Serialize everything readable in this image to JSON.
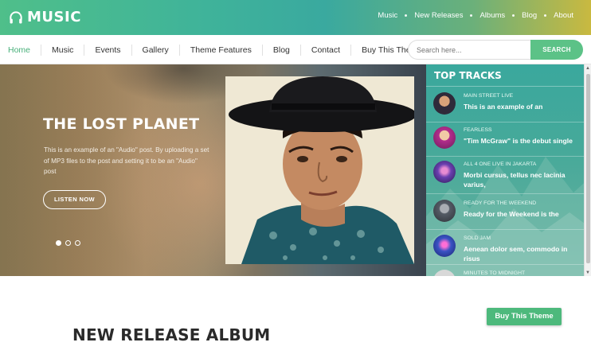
{
  "brand": {
    "name": "MUSIC"
  },
  "top_nav": {
    "items": [
      "Music",
      "New Releases",
      "Albums",
      "Blog",
      "About"
    ]
  },
  "main_nav": {
    "items": [
      "Home",
      "Music",
      "Events",
      "Gallery",
      "Theme Features",
      "Blog",
      "Contact",
      "Buy This Theme"
    ],
    "active": "Home"
  },
  "search": {
    "placeholder": "Search here...",
    "button": "SEARCH"
  },
  "hero": {
    "title": "THE LOST PLANET",
    "description": "This is an example of an \"Audio\" post. By uploading a set of MP3 files to the post and setting it to be an \"Audio\" post",
    "button": "LISTEN NOW",
    "slides": 3,
    "active_slide": 1
  },
  "top_tracks": {
    "title": "TOP TRACKS",
    "items": [
      {
        "label": "MAIN STREET LIVE",
        "title": "This is an example of an",
        "color": "#2f2a3a"
      },
      {
        "label": "FEARLESS",
        "title": "\"Tim McGraw\" is the debut single",
        "color": "#b42d8e"
      },
      {
        "label": "ALL 4 ONE LIVE IN JAKARTA",
        "title": "Morbi cursus, tellus nec lacinia varius,",
        "color": "#6a3fb0"
      },
      {
        "label": "READY FOR THE WEEKEND",
        "title": "Ready for the Weekend is the",
        "color": "#555c66"
      },
      {
        "label": "SOLD JAM",
        "title": "Aenean dolor sem, commodo in risus",
        "color": "#3a53c4"
      },
      {
        "label": "MINUTES TO MIDNIGHT",
        "title": "",
        "color": "#d8d8d8"
      }
    ]
  },
  "cta": {
    "label": "Buy This Theme"
  },
  "section": {
    "heading": "NEW RELEASE ALBUM"
  },
  "colors": {
    "accent": "#4db97c",
    "panel": "#3aa89d"
  }
}
